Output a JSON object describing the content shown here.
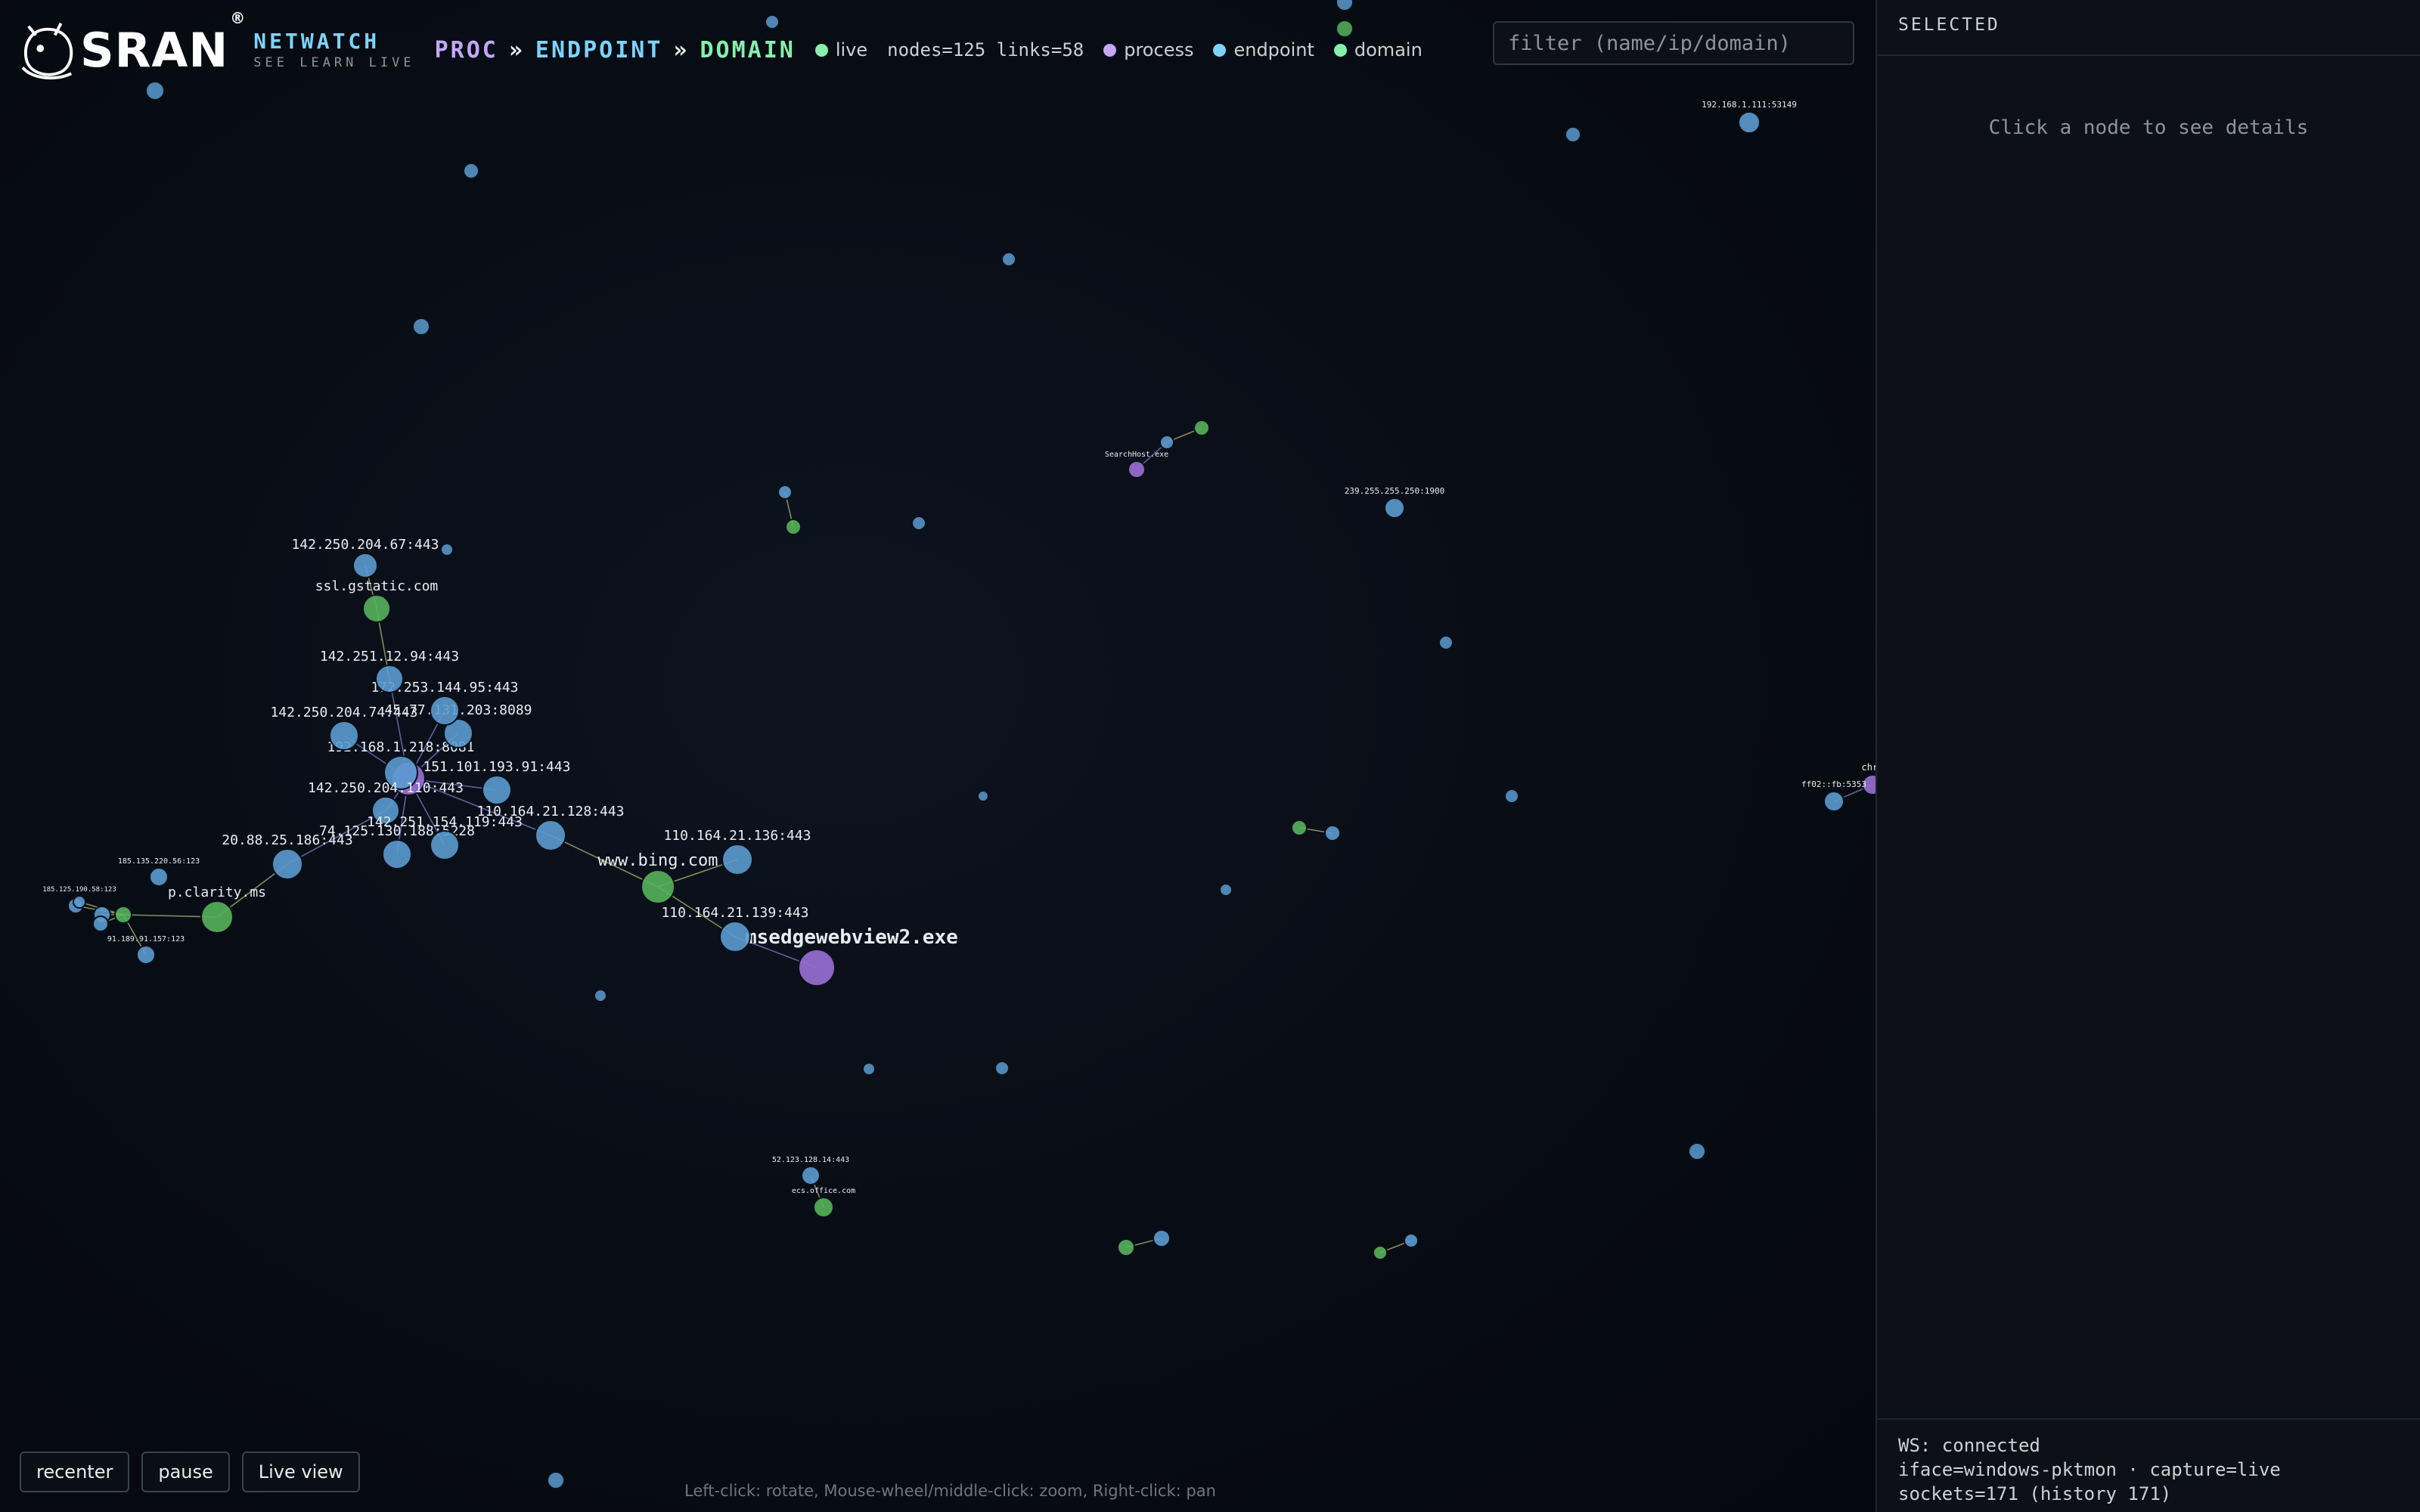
{
  "header": {
    "brand": "SRAN",
    "brand_reg": "®",
    "brand_line1": "NETWATCH",
    "brand_line2": "SEE LEARN LIVE",
    "crumbs": [
      "PROC",
      "ENDPOINT",
      "DOMAIN"
    ],
    "crumb_sep": "»",
    "live_label": "live",
    "stats": "nodes=125 links=58",
    "legend": [
      {
        "label": "process",
        "color": "#c4a7f7"
      },
      {
        "label": "endpoint",
        "color": "#7dd3fc"
      },
      {
        "label": "domain",
        "color": "#86efac"
      }
    ],
    "live_color": "#86efac"
  },
  "filter": {
    "placeholder": "filter (name/ip/domain)",
    "value": ""
  },
  "controls": {
    "recenter": "recenter",
    "pause": "pause",
    "live_view": "Live view"
  },
  "help_text": "Left-click: rotate, Mouse-wheel/middle-click: zoom, Right-click: pan",
  "sidebar": {
    "title": "SELECTED",
    "empty": "Click a node to see details",
    "footer": [
      "WS: connected",
      "iface=windows-pktmon · capture=live",
      "sockets=171 (history 171)"
    ]
  },
  "colors": {
    "process": "#9b6fd6",
    "endpoint": "#5b9bd0",
    "domain": "#57b35b"
  },
  "graph": {
    "nodes": [
      {
        "id": "msedge",
        "type": "process",
        "label": "msedgewebview2.exe"
      },
      {
        "id": "bing",
        "type": "domain",
        "label": "www.bing.com"
      },
      {
        "id": "e136",
        "type": "endpoint",
        "label": "110.164.21.136:443"
      },
      {
        "id": "e139",
        "type": "endpoint",
        "label": "110.164.21.139:443"
      },
      {
        "id": "e128",
        "type": "endpoint",
        "label": "110.164.21.128:443"
      },
      {
        "id": "p2",
        "type": "process",
        "label": ""
      },
      {
        "id": "e151",
        "type": "endpoint",
        "label": "151.101.193.91:443"
      },
      {
        "id": "e1921",
        "type": "endpoint",
        "label": "192.168.1.218:8081"
      },
      {
        "id": "e45",
        "type": "endpoint",
        "label": "45.77.131.203:8089"
      },
      {
        "id": "e172",
        "type": "endpoint",
        "label": "172.253.144.95:443"
      },
      {
        "id": "e14274",
        "type": "endpoint",
        "label": "142.250.204.74:443"
      },
      {
        "id": "e14294",
        "type": "endpoint",
        "label": "142.251.12.94:443"
      },
      {
        "id": "gstatic",
        "type": "domain",
        "label": "ssl.gstatic.com"
      },
      {
        "id": "e14267",
        "type": "endpoint",
        "label": "142.250.204.67:443"
      },
      {
        "id": "e142110",
        "type": "endpoint",
        "label": "142.250.204.110:443"
      },
      {
        "id": "e74",
        "type": "endpoint",
        "label": "74.125.130.188:5228"
      },
      {
        "id": "e142119",
        "type": "endpoint",
        "label": "142.251.154.119:443"
      },
      {
        "id": "e20",
        "type": "endpoint",
        "label": "20.88.25.186:443"
      },
      {
        "id": "clarity",
        "type": "domain",
        "label": "p.clarity.ms"
      },
      {
        "id": "ea",
        "type": "endpoint",
        "label": "185.135.220.56:123"
      },
      {
        "id": "eb",
        "type": "endpoint",
        "label": "91.189.91.157:123"
      },
      {
        "id": "ec",
        "type": "endpoint",
        "label": ""
      },
      {
        "id": "ed",
        "type": "endpoint",
        "label": ""
      },
      {
        "id": "ee",
        "type": "domain",
        "label": ""
      },
      {
        "id": "ef",
        "type": "endpoint",
        "label": ""
      },
      {
        "id": "eg",
        "type": "endpoint",
        "label": "185.125.190.58:123"
      },
      {
        "id": "e192111",
        "type": "endpoint",
        "label": "192.168.1.111:53149"
      },
      {
        "id": "e239",
        "type": "endpoint",
        "label": "239.255.255.250:1900"
      },
      {
        "id": "searchhost",
        "type": "process",
        "label": "SearchHost.exe"
      },
      {
        "id": "sdom",
        "type": "domain",
        "label": ""
      },
      {
        "id": "sep",
        "type": "endpoint",
        "label": ""
      },
      {
        "id": "gdom",
        "type": "domain",
        "label": ""
      },
      {
        "id": "gep",
        "type": "endpoint",
        "label": ""
      },
      {
        "id": "e52",
        "type": "endpoint",
        "label": "52.123.128.14:443"
      },
      {
        "id": "officedom",
        "type": "domain",
        "label": "ecs.office.com"
      },
      {
        "id": "cdom",
        "type": "domain",
        "label": ""
      },
      {
        "id": "cep",
        "type": "endpoint",
        "label": ""
      },
      {
        "id": "kdom",
        "type": "domain",
        "label": ""
      },
      {
        "id": "kep",
        "type": "endpoint",
        "label": ""
      },
      {
        "id": "mdom",
        "type": "domain",
        "label": ""
      },
      {
        "id": "mep",
        "type": "endpoint",
        "label": ""
      },
      {
        "id": "pchrome",
        "type": "process",
        "label": "chro"
      },
      {
        "id": "eff",
        "type": "endpoint",
        "label": "ff02::fb:5353"
      },
      {
        "id": "iso1",
        "type": "endpoint",
        "label": ""
      },
      {
        "id": "iso2",
        "type": "endpoint",
        "label": ""
      },
      {
        "id": "iso3",
        "type": "endpoint",
        "label": ""
      },
      {
        "id": "iso4",
        "type": "endpoint",
        "label": ""
      },
      {
        "id": "iso5",
        "type": "endpoint",
        "label": ""
      },
      {
        "id": "iso6",
        "type": "endpoint",
        "label": ""
      },
      {
        "id": "iso7",
        "type": "endpoint",
        "label": ""
      },
      {
        "id": "iso8",
        "type": "endpoint",
        "label": ""
      },
      {
        "id": "iso9",
        "type": "endpoint",
        "label": ""
      },
      {
        "id": "iso10",
        "type": "endpoint",
        "label": ""
      },
      {
        "id": "iso11",
        "type": "endpoint",
        "label": ""
      },
      {
        "id": "iso12",
        "type": "endpoint",
        "label": ""
      },
      {
        "id": "iso13",
        "type": "endpoint",
        "label": ""
      },
      {
        "id": "iso14",
        "type": "endpoint",
        "label": ""
      },
      {
        "id": "iso15",
        "type": "endpoint",
        "label": ""
      },
      {
        "id": "iso16",
        "type": "endpoint",
        "label": ""
      },
      {
        "id": "iso17",
        "type": "endpoint",
        "label": ""
      },
      {
        "id": "iso18",
        "type": "endpoint",
        "label": ""
      },
      {
        "id": "iso19",
        "type": "domain",
        "label": ""
      }
    ],
    "links": [
      [
        "msedge",
        "e139"
      ],
      [
        "e139",
        "bing"
      ],
      [
        "bing",
        "e136"
      ],
      [
        "bing",
        "e128"
      ],
      [
        "e128",
        "p2"
      ],
      [
        "p2",
        "e151"
      ],
      [
        "p2",
        "e1921"
      ],
      [
        "p2",
        "e45"
      ],
      [
        "p2",
        "e172"
      ],
      [
        "p2",
        "e14274"
      ],
      [
        "p2",
        "e14294"
      ],
      [
        "e14294",
        "gstatic"
      ],
      [
        "gstatic",
        "e14267"
      ],
      [
        "p2",
        "e142110"
      ],
      [
        "p2",
        "e74"
      ],
      [
        "p2",
        "e142119"
      ],
      [
        "e142110",
        "e20"
      ],
      [
        "e20",
        "clarity"
      ],
      [
        "clarity",
        "ee"
      ],
      [
        "ee",
        "eb"
      ],
      [
        "ee",
        "ec"
      ],
      [
        "ee",
        "ed"
      ],
      [
        "ee",
        "ef"
      ],
      [
        "ee",
        "eg"
      ],
      [
        "searchhost",
        "sep"
      ],
      [
        "sep",
        "sdom"
      ],
      [
        "gdom",
        "gep"
      ],
      [
        "e52",
        "officedom"
      ],
      [
        "cdom",
        "cep"
      ],
      [
        "kdom",
        "kep"
      ],
      [
        "mdom",
        "mep"
      ],
      [
        "pchrome",
        "eff"
      ]
    ]
  }
}
